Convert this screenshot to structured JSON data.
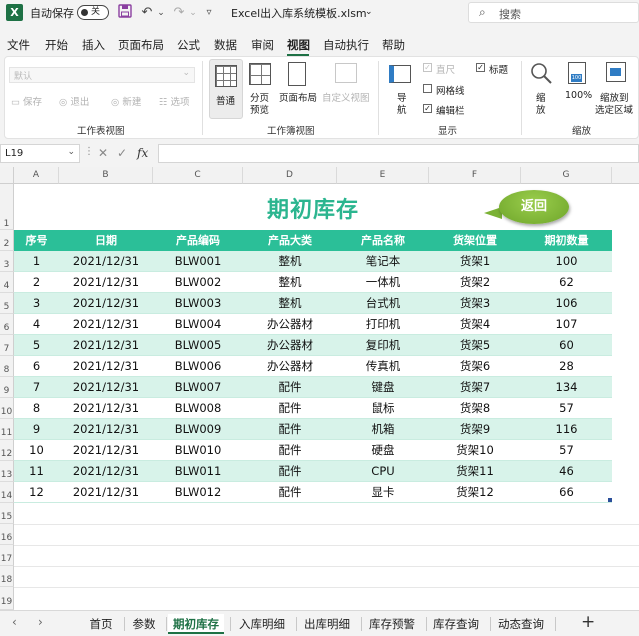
{
  "titlebar": {
    "autosave_label": "自动保存",
    "autosave_state": "关",
    "filename": "Excel出入库系统模板.xlsm",
    "search_placeholder": "搜索"
  },
  "menu": [
    "文件",
    "开始",
    "插入",
    "页面布局",
    "公式",
    "数据",
    "审阅",
    "视图",
    "自动执行",
    "帮助"
  ],
  "active_menu": "视图",
  "ribbon": {
    "sheet_view": {
      "dropdown_value": "默认",
      "keep": "保存",
      "exit": "退出",
      "new": "新建",
      "options": "选项",
      "label": "工作表视图"
    },
    "workbook_view": {
      "normal": "普通",
      "page_break_1": "分页",
      "page_break_2": "预览",
      "page_layout": "页面布局",
      "custom_views": "自定义视图",
      "label": "工作簿视图"
    },
    "show": {
      "navigate": "导航",
      "ruler": "直尺",
      "gridlines": "网格线",
      "formula_bar": "编辑栏",
      "headings": "标题",
      "label": "显示"
    },
    "zoom": {
      "zoom": "缩放",
      "percent": "100%",
      "zoom_selection_1": "缩放到",
      "zoom_selection_2": "选定区域",
      "label": "缩放"
    }
  },
  "formula_bar": {
    "name_box": "L19",
    "fx": "fx",
    "value": ""
  },
  "columns": [
    "A",
    "B",
    "C",
    "D",
    "E",
    "F",
    "G"
  ],
  "rows": [
    "1",
    "2",
    "3",
    "4",
    "5",
    "6",
    "7",
    "8",
    "9",
    "10",
    "11",
    "12",
    "13",
    "14",
    "15",
    "16",
    "17",
    "18",
    "19"
  ],
  "sheet_title": "期初库存",
  "return_button": "返回",
  "table": {
    "headers": [
      "序号",
      "日期",
      "产品编码",
      "产品大类",
      "产品名称",
      "货架位置",
      "期初数量"
    ],
    "rows": [
      [
        "1",
        "2021/12/31",
        "BLW001",
        "整机",
        "笔记本",
        "货架1",
        "100"
      ],
      [
        "2",
        "2021/12/31",
        "BLW002",
        "整机",
        "一体机",
        "货架2",
        "62"
      ],
      [
        "3",
        "2021/12/31",
        "BLW003",
        "整机",
        "台式机",
        "货架3",
        "106"
      ],
      [
        "4",
        "2021/12/31",
        "BLW004",
        "办公器材",
        "打印机",
        "货架4",
        "107"
      ],
      [
        "5",
        "2021/12/31",
        "BLW005",
        "办公器材",
        "复印机",
        "货架5",
        "60"
      ],
      [
        "6",
        "2021/12/31",
        "BLW006",
        "办公器材",
        "传真机",
        "货架6",
        "28"
      ],
      [
        "7",
        "2021/12/31",
        "BLW007",
        "配件",
        "键盘",
        "货架7",
        "134"
      ],
      [
        "8",
        "2021/12/31",
        "BLW008",
        "配件",
        "鼠标",
        "货架8",
        "57"
      ],
      [
        "9",
        "2021/12/31",
        "BLW009",
        "配件",
        "机箱",
        "货架9",
        "116"
      ],
      [
        "10",
        "2021/12/31",
        "BLW010",
        "配件",
        "硬盘",
        "货架10",
        "57"
      ],
      [
        "11",
        "2021/12/31",
        "BLW011",
        "配件",
        "CPU",
        "货架11",
        "46"
      ],
      [
        "12",
        "2021/12/31",
        "BLW012",
        "配件",
        "显卡",
        "货架12",
        "66"
      ]
    ]
  },
  "sheet_tabs": [
    "首页",
    "参数",
    "期初库存",
    "入库明细",
    "出库明细",
    "库存预警",
    "库存查询",
    "动态查询"
  ],
  "active_tab": "期初库存",
  "colors": {
    "accent": "#2bbf98",
    "title": "#2bb58f",
    "row_alt": "#d8f3ea",
    "return_btn": "#7bb235",
    "excel_green": "#1e7145"
  }
}
